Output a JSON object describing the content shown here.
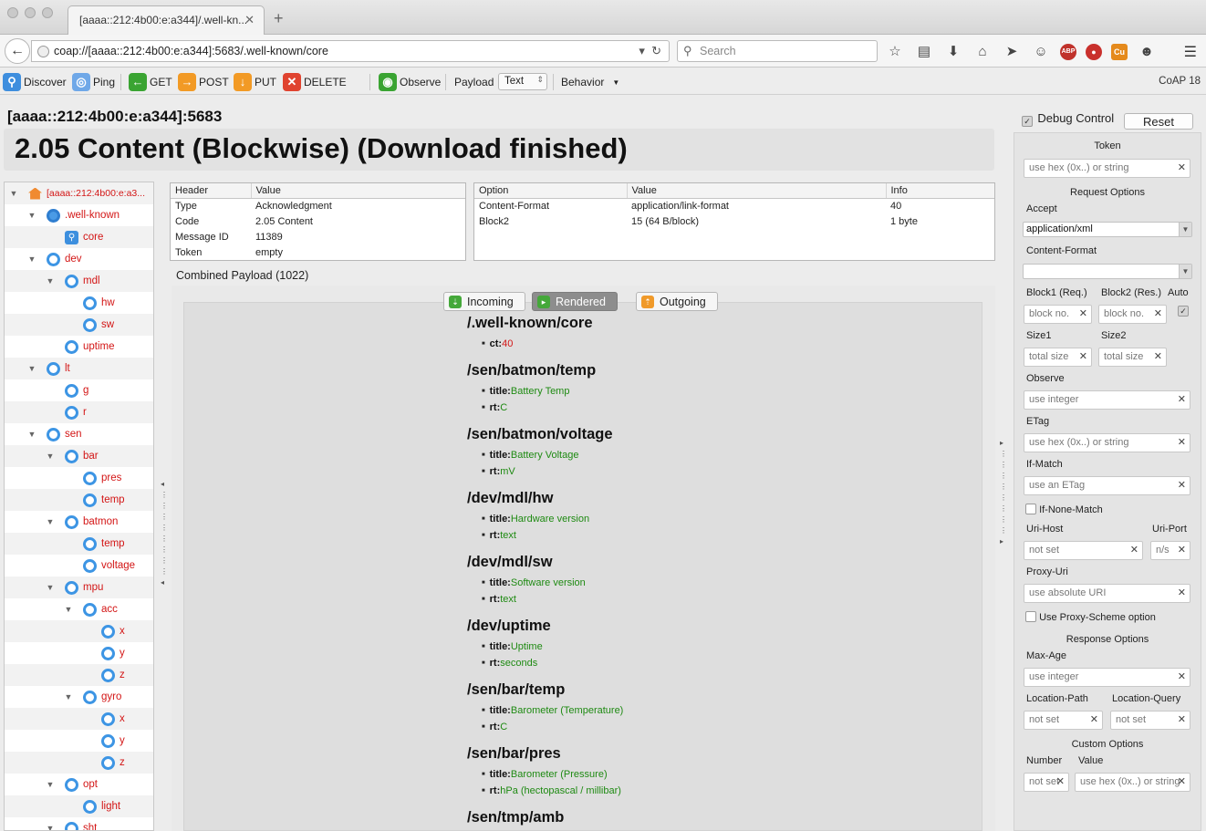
{
  "browser": {
    "tab_title": "[aaaa::212:4b00:e:a344]/.well-kn...",
    "url": "coap://[aaaa::212:4b00:e:a344]:5683/.well-known/core",
    "search_placeholder": "Search"
  },
  "toolbar": {
    "discover": "Discover",
    "ping": "Ping",
    "get": "GET",
    "post": "POST",
    "put": "PUT",
    "delete": "DELETE",
    "observe": "Observe",
    "payload_label": "Payload",
    "payload_value": "Text",
    "behavior": "Behavior",
    "version": "CoAP 18"
  },
  "main": {
    "address": "[aaaa::212:4b00:e:a344]:5683",
    "status": "2.05 Content (Blockwise) (Download finished)"
  },
  "tree": [
    {
      "label": "[aaaa::212:4b00:e:a3...",
      "depth": 0,
      "icon": "home-icon",
      "twisty": "open"
    },
    {
      "label": ".well-known",
      "depth": 1,
      "icon": "globe-icon",
      "twisty": "open"
    },
    {
      "label": "core",
      "depth": 2,
      "icon": "discover-icon",
      "twisty": ""
    },
    {
      "label": "dev",
      "depth": 1,
      "icon": "resource-icon",
      "twisty": "open"
    },
    {
      "label": "mdl",
      "depth": 2,
      "icon": "resource-icon",
      "twisty": "open"
    },
    {
      "label": "hw",
      "depth": 3,
      "icon": "resource-icon",
      "twisty": ""
    },
    {
      "label": "sw",
      "depth": 3,
      "icon": "resource-icon",
      "twisty": ""
    },
    {
      "label": "uptime",
      "depth": 2,
      "icon": "resource-icon",
      "twisty": ""
    },
    {
      "label": "lt",
      "depth": 1,
      "icon": "resource-icon",
      "twisty": "open"
    },
    {
      "label": "g",
      "depth": 2,
      "icon": "resource-icon",
      "twisty": ""
    },
    {
      "label": "r",
      "depth": 2,
      "icon": "resource-icon",
      "twisty": ""
    },
    {
      "label": "sen",
      "depth": 1,
      "icon": "resource-icon",
      "twisty": "open"
    },
    {
      "label": "bar",
      "depth": 2,
      "icon": "resource-icon",
      "twisty": "open"
    },
    {
      "label": "pres",
      "depth": 3,
      "icon": "resource-icon",
      "twisty": ""
    },
    {
      "label": "temp",
      "depth": 3,
      "icon": "resource-icon",
      "twisty": ""
    },
    {
      "label": "batmon",
      "depth": 2,
      "icon": "resource-icon",
      "twisty": "open"
    },
    {
      "label": "temp",
      "depth": 3,
      "icon": "resource-icon",
      "twisty": ""
    },
    {
      "label": "voltage",
      "depth": 3,
      "icon": "resource-icon",
      "twisty": ""
    },
    {
      "label": "mpu",
      "depth": 2,
      "icon": "resource-icon",
      "twisty": "open"
    },
    {
      "label": "acc",
      "depth": 3,
      "icon": "resource-icon",
      "twisty": "open"
    },
    {
      "label": "x",
      "depth": 4,
      "icon": "resource-icon",
      "twisty": ""
    },
    {
      "label": "y",
      "depth": 4,
      "icon": "resource-icon",
      "twisty": ""
    },
    {
      "label": "z",
      "depth": 4,
      "icon": "resource-icon",
      "twisty": ""
    },
    {
      "label": "gyro",
      "depth": 3,
      "icon": "resource-icon",
      "twisty": "open"
    },
    {
      "label": "x",
      "depth": 4,
      "icon": "resource-icon",
      "twisty": ""
    },
    {
      "label": "y",
      "depth": 4,
      "icon": "resource-icon",
      "twisty": ""
    },
    {
      "label": "z",
      "depth": 4,
      "icon": "resource-icon",
      "twisty": ""
    },
    {
      "label": "opt",
      "depth": 2,
      "icon": "resource-icon",
      "twisty": "open"
    },
    {
      "label": "light",
      "depth": 3,
      "icon": "resource-icon",
      "twisty": ""
    },
    {
      "label": "sht",
      "depth": 2,
      "icon": "resource-icon",
      "twisty": "open"
    }
  ],
  "header_table": {
    "columns": [
      "Header",
      "Value"
    ],
    "rows": [
      [
        "Type",
        "Acknowledgment"
      ],
      [
        "Code",
        "2.05 Content"
      ],
      [
        "Message ID",
        "11389"
      ],
      [
        "Token",
        "empty"
      ]
    ]
  },
  "option_table": {
    "columns": [
      "Option",
      "Value",
      "Info"
    ],
    "rows": [
      [
        "Content-Format",
        "application/link-format",
        "40"
      ],
      [
        "Block2",
        "15 (64 B/block)",
        "1 byte"
      ]
    ]
  },
  "payload": {
    "label": "Combined Payload (1022)",
    "tabs": {
      "incoming": "Incoming",
      "rendered": "Rendered",
      "outgoing": "Outgoing"
    },
    "links": [
      {
        "path": "/.well-known/core",
        "attrs": [
          {
            "k": "ct:",
            "v": "40",
            "color": "red"
          }
        ]
      },
      {
        "path": "/sen/batmon/temp",
        "attrs": [
          {
            "k": "title:",
            "v": "Battery Temp",
            "color": "green"
          },
          {
            "k": "rt:",
            "v": "C",
            "color": "green"
          }
        ]
      },
      {
        "path": "/sen/batmon/voltage",
        "attrs": [
          {
            "k": "title:",
            "v": "Battery Voltage",
            "color": "green"
          },
          {
            "k": "rt:",
            "v": "mV",
            "color": "green"
          }
        ]
      },
      {
        "path": "/dev/mdl/hw",
        "attrs": [
          {
            "k": "title:",
            "v": "Hardware version",
            "color": "green"
          },
          {
            "k": "rt:",
            "v": "text",
            "color": "green"
          }
        ]
      },
      {
        "path": "/dev/mdl/sw",
        "attrs": [
          {
            "k": "title:",
            "v": "Software version",
            "color": "green"
          },
          {
            "k": "rt:",
            "v": "text",
            "color": "green"
          }
        ]
      },
      {
        "path": "/dev/uptime",
        "attrs": [
          {
            "k": "title:",
            "v": "Uptime",
            "color": "green"
          },
          {
            "k": "rt:",
            "v": "seconds",
            "color": "green"
          }
        ]
      },
      {
        "path": "/sen/bar/temp",
        "attrs": [
          {
            "k": "title:",
            "v": "Barometer (Temperature)",
            "color": "green"
          },
          {
            "k": "rt:",
            "v": "C",
            "color": "green"
          }
        ]
      },
      {
        "path": "/sen/bar/pres",
        "attrs": [
          {
            "k": "title:",
            "v": "Barometer (Pressure)",
            "color": "green"
          },
          {
            "k": "rt:",
            "v": "hPa (hectopascal / millibar)",
            "color": "green"
          }
        ]
      },
      {
        "path": "/sen/tmp/amb",
        "attrs": []
      }
    ]
  },
  "debug": {
    "title": "Debug Control",
    "reset": "Reset",
    "token_label": "Token",
    "token_placeholder": "use hex (0x..) or string",
    "request_options": "Request Options",
    "accept_label": "Accept",
    "accept_value": "application/xml",
    "content_format_label": "Content-Format",
    "content_format_value": "",
    "block1_label": "Block1 (Req.)",
    "block2_label": "Block2 (Res.)",
    "auto_label": "Auto",
    "block_placeholder": "block no.",
    "size1_label": "Size1",
    "size2_label": "Size2",
    "size_placeholder": "total size",
    "observe_label": "Observe",
    "integer_placeholder": "use integer",
    "etag_label": "ETag",
    "hex_placeholder": "use hex (0x..) or string",
    "ifmatch_label": "If-Match",
    "etag_placeholder": "use an ETag",
    "ifnonematch_label": "If-None-Match",
    "urihost_label": "Uri-Host",
    "uriport_label": "Uri-Port",
    "notset_placeholder": "not set",
    "ns_placeholder": "n/s",
    "proxyuri_label": "Proxy-Uri",
    "proxyuri_placeholder": "use absolute URI",
    "proxyscheme_label": "Use Proxy-Scheme option",
    "response_options": "Response Options",
    "maxage_label": "Max-Age",
    "locpath_label": "Location-Path",
    "locquery_label": "Location-Query",
    "custom_options": "Custom Options",
    "number_label": "Number",
    "value_label": "Value",
    "number_placeholder": "not set",
    "value_placeholder": "use hex (0x..) or string"
  }
}
